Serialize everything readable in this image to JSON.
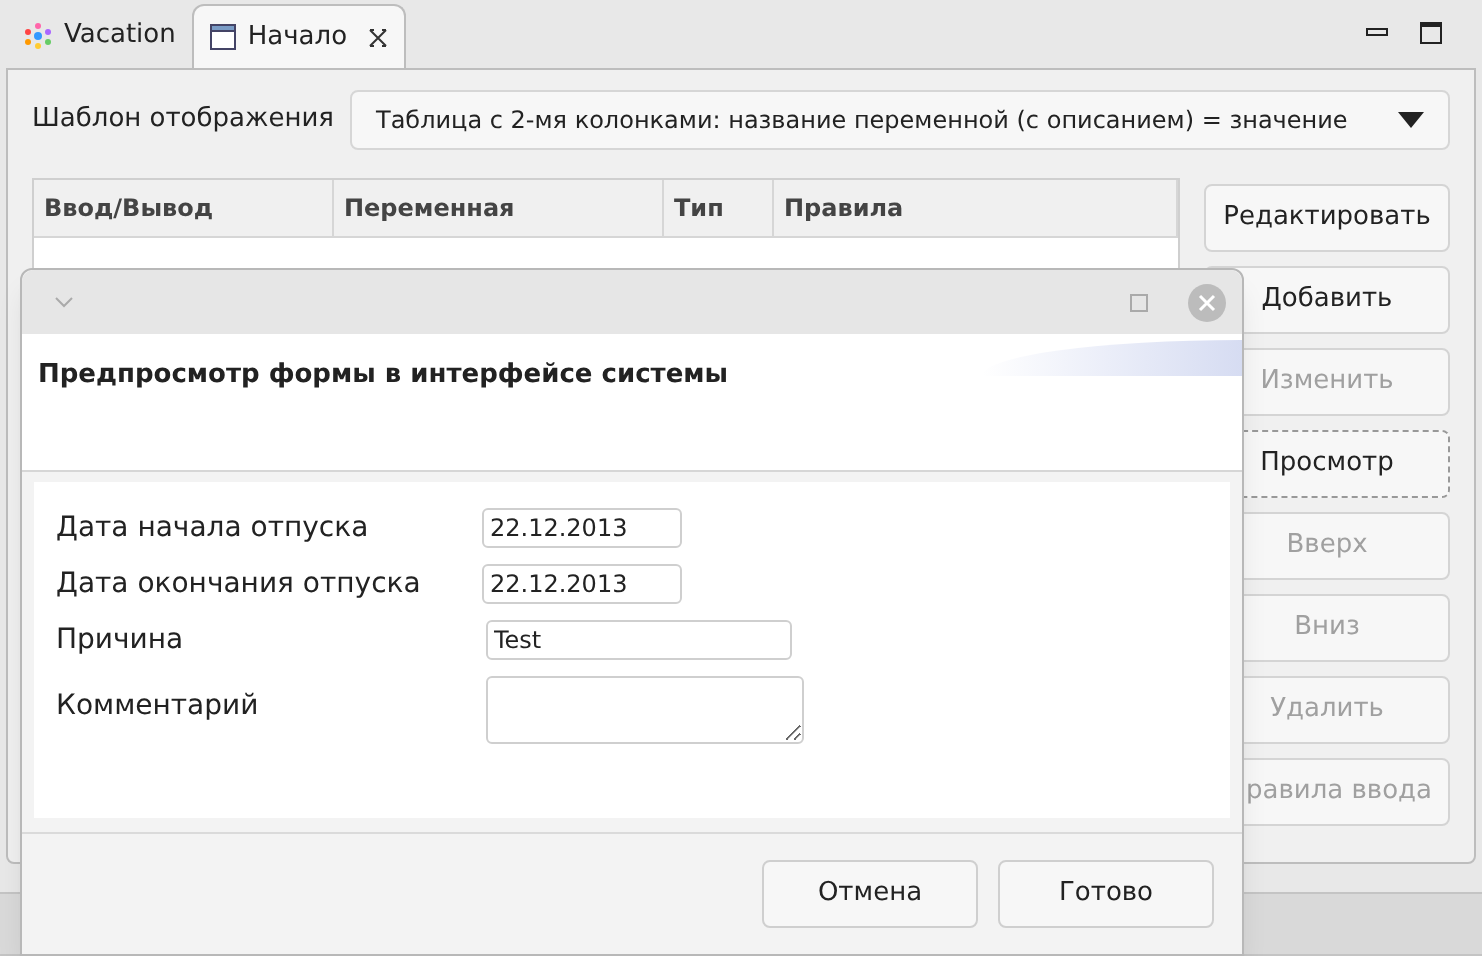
{
  "tabs": [
    {
      "label": "Vacation",
      "selected": false
    },
    {
      "label": "Начало",
      "selected": true
    }
  ],
  "template": {
    "label": "Шаблон отображения",
    "value": "Таблица с 2-мя колонками: название переменной (с описанием) = значение"
  },
  "table": {
    "columns": [
      "Ввод/Вывод",
      "Переменная",
      "Тип",
      "Правила"
    ]
  },
  "side_buttons": [
    {
      "label": "Редактировать",
      "disabled": false,
      "focused": false
    },
    {
      "label": "Добавить",
      "disabled": false,
      "focused": false
    },
    {
      "label": "Изменить",
      "disabled": true,
      "focused": false
    },
    {
      "label": "Просмотр",
      "disabled": false,
      "focused": true
    },
    {
      "label": "Вверх",
      "disabled": true,
      "focused": false
    },
    {
      "label": "Вниз",
      "disabled": true,
      "focused": false
    },
    {
      "label": "Удалить",
      "disabled": true,
      "focused": false
    },
    {
      "label": "равила ввода",
      "disabled": true,
      "focused": false
    }
  ],
  "dialog": {
    "heading": "Предпросмотр формы в интерфейсе системы",
    "fields": [
      {
        "label": "Дата начала отпуска",
        "value": "22.12.2013",
        "kind": "date"
      },
      {
        "label": "Дата окончания отпуска",
        "value": "22.12.2013",
        "kind": "date"
      },
      {
        "label": "Причина",
        "value": "Test",
        "kind": "text"
      },
      {
        "label": "Комментарий",
        "kind": "textarea"
      }
    ],
    "buttons": [
      "Отмена",
      "Готово"
    ]
  }
}
